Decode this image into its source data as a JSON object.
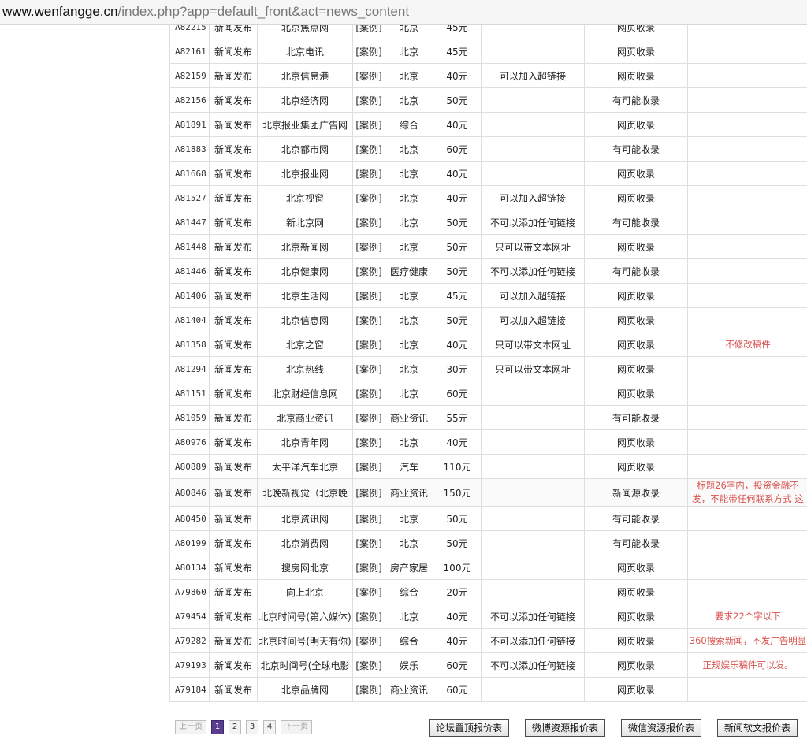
{
  "url": {
    "host": "www.wenfangge.cn",
    "path": "/index.php?app=default_front&act=news_content"
  },
  "colors": {
    "note": "#d9534f",
    "current_page": "#5a3e8e"
  },
  "rows": [
    {
      "id": "A82215",
      "type": "新闻发布",
      "name": "北京焦点网",
      "tag": "[案例]",
      "cat": "北京",
      "price": "45元",
      "link": "",
      "index": "网页收录",
      "note": ""
    },
    {
      "id": "A82161",
      "type": "新闻发布",
      "name": "北京电讯",
      "tag": "[案例]",
      "cat": "北京",
      "price": "45元",
      "link": "",
      "index": "网页收录",
      "note": ""
    },
    {
      "id": "A82159",
      "type": "新闻发布",
      "name": "北京信息港",
      "tag": "[案例]",
      "cat": "北京",
      "price": "40元",
      "link": "可以加入超链接",
      "index": "网页收录",
      "note": ""
    },
    {
      "id": "A82156",
      "type": "新闻发布",
      "name": "北京经济网",
      "tag": "[案例]",
      "cat": "北京",
      "price": "50元",
      "link": "",
      "index": "有可能收录",
      "note": ""
    },
    {
      "id": "A81891",
      "type": "新闻发布",
      "name": "北京报业集团广告网",
      "tag": "[案例]",
      "cat": "综合",
      "price": "40元",
      "link": "",
      "index": "网页收录",
      "note": ""
    },
    {
      "id": "A81883",
      "type": "新闻发布",
      "name": "北京都市网",
      "tag": "[案例]",
      "cat": "北京",
      "price": "60元",
      "link": "",
      "index": "有可能收录",
      "note": ""
    },
    {
      "id": "A81668",
      "type": "新闻发布",
      "name": "北京报业网",
      "tag": "[案例]",
      "cat": "北京",
      "price": "40元",
      "link": "",
      "index": "网页收录",
      "note": ""
    },
    {
      "id": "A81527",
      "type": "新闻发布",
      "name": "北京视窗",
      "tag": "[案例]",
      "cat": "北京",
      "price": "40元",
      "link": "可以加入超链接",
      "index": "网页收录",
      "note": ""
    },
    {
      "id": "A81447",
      "type": "新闻发布",
      "name": "新北京网",
      "tag": "[案例]",
      "cat": "北京",
      "price": "50元",
      "link": "不可以添加任何链接",
      "index": "有可能收录",
      "note": ""
    },
    {
      "id": "A81448",
      "type": "新闻发布",
      "name": "北京新闻网",
      "tag": "[案例]",
      "cat": "北京",
      "price": "50元",
      "link": "只可以带文本网址",
      "index": "网页收录",
      "note": ""
    },
    {
      "id": "A81446",
      "type": "新闻发布",
      "name": "北京健康网",
      "tag": "[案例]",
      "cat": "医疗健康",
      "price": "50元",
      "link": "不可以添加任何链接",
      "index": "有可能收录",
      "note": ""
    },
    {
      "id": "A81406",
      "type": "新闻发布",
      "name": "北京生活网",
      "tag": "[案例]",
      "cat": "北京",
      "price": "45元",
      "link": "可以加入超链接",
      "index": "网页收录",
      "note": ""
    },
    {
      "id": "A81404",
      "type": "新闻发布",
      "name": "北京信息网",
      "tag": "[案例]",
      "cat": "北京",
      "price": "50元",
      "link": "可以加入超链接",
      "index": "网页收录",
      "note": ""
    },
    {
      "id": "A81358",
      "type": "新闻发布",
      "name": "北京之窗",
      "tag": "[案例]",
      "cat": "北京",
      "price": "40元",
      "link": "只可以带文本网址",
      "index": "网页收录",
      "note": "不修改稿件"
    },
    {
      "id": "A81294",
      "type": "新闻发布",
      "name": "北京热线",
      "tag": "[案例]",
      "cat": "北京",
      "price": "30元",
      "link": "只可以带文本网址",
      "index": "网页收录",
      "note": ""
    },
    {
      "id": "A81151",
      "type": "新闻发布",
      "name": "北京财经信息网",
      "tag": "[案例]",
      "cat": "北京",
      "price": "60元",
      "link": "",
      "index": "网页收录",
      "note": ""
    },
    {
      "id": "A81059",
      "type": "新闻发布",
      "name": "北京商业资讯",
      "tag": "[案例]",
      "cat": "商业资讯",
      "price": "55元",
      "link": "",
      "index": "有可能收录",
      "note": ""
    },
    {
      "id": "A80976",
      "type": "新闻发布",
      "name": "北京青年网",
      "tag": "[案例]",
      "cat": "北京",
      "price": "40元",
      "link": "",
      "index": "网页收录",
      "note": ""
    },
    {
      "id": "A80889",
      "type": "新闻发布",
      "name": "太平洋汽车北京",
      "tag": "[案例]",
      "cat": "汽车",
      "price": "110元",
      "link": "",
      "index": "网页收录",
      "note": ""
    },
    {
      "id": "A80846",
      "type": "新闻发布",
      "name": "北晚新视觉（北京晚",
      "tag": "[案例]",
      "cat": "商业资讯",
      "price": "150元",
      "link": "",
      "index": "新闻源收录",
      "note": "标题26字内，投资金融不发，不能带任何联系方式 这"
    },
    {
      "id": "A80450",
      "type": "新闻发布",
      "name": "北京资讯网",
      "tag": "[案例]",
      "cat": "北京",
      "price": "50元",
      "link": "",
      "index": "有可能收录",
      "note": ""
    },
    {
      "id": "A80199",
      "type": "新闻发布",
      "name": "北京消费网",
      "tag": "[案例]",
      "cat": "北京",
      "price": "50元",
      "link": "",
      "index": "有可能收录",
      "note": ""
    },
    {
      "id": "A80134",
      "type": "新闻发布",
      "name": "搜房网北京",
      "tag": "[案例]",
      "cat": "房产家居",
      "price": "100元",
      "link": "",
      "index": "网页收录",
      "note": ""
    },
    {
      "id": "A79860",
      "type": "新闻发布",
      "name": "向上北京",
      "tag": "[案例]",
      "cat": "综合",
      "price": "20元",
      "link": "",
      "index": "网页收录",
      "note": ""
    },
    {
      "id": "A79454",
      "type": "新闻发布",
      "name": "北京时间号(第六媒体)",
      "tag": "[案例]",
      "cat": "北京",
      "price": "40元",
      "link": "不可以添加任何链接",
      "index": "网页收录",
      "note": "要求22个字以下"
    },
    {
      "id": "A79282",
      "type": "新闻发布",
      "name": "北京时间号(明天有你)",
      "tag": "[案例]",
      "cat": "综合",
      "price": "40元",
      "link": "不可以添加任何链接",
      "index": "网页收录",
      "note": "360搜索新闻，不发广告明显"
    },
    {
      "id": "A79193",
      "type": "新闻发布",
      "name": "北京时间号(全球电影",
      "tag": "[案例]",
      "cat": "娱乐",
      "price": "60元",
      "link": "不可以添加任何链接",
      "index": "网页收录",
      "note": "正规娱乐稿件可以发。"
    },
    {
      "id": "A79184",
      "type": "新闻发布",
      "name": "北京品牌网",
      "tag": "[案例]",
      "cat": "商业资讯",
      "price": "60元",
      "link": "",
      "index": "网页收录",
      "note": ""
    }
  ],
  "pager": {
    "prev": "上一页",
    "pages": [
      "1",
      "2",
      "3",
      "4"
    ],
    "current": "1",
    "next": "下一页"
  },
  "report_buttons": [
    "论坛置顶报价表",
    "微博资源报价表",
    "微信资源报价表",
    "新闻软文报价表"
  ]
}
